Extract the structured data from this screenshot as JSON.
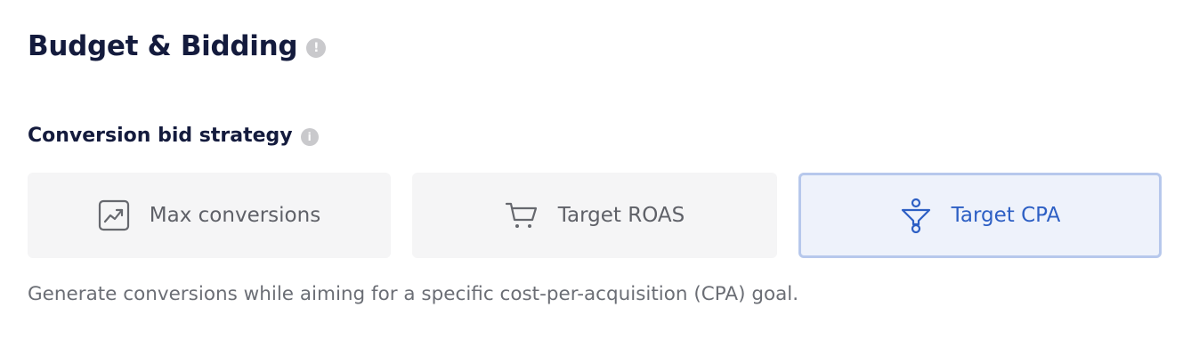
{
  "section": {
    "title": "Budget & Bidding",
    "info_glyph": "!"
  },
  "bid_strategy": {
    "label": "Conversion bid strategy",
    "info_glyph": "i",
    "options": [
      {
        "label": "Max conversions",
        "icon": "trend-chart-icon",
        "selected": false
      },
      {
        "label": "Target ROAS",
        "icon": "shopping-cart-icon",
        "selected": false
      },
      {
        "label": "Target CPA",
        "icon": "funnel-icon",
        "selected": true
      }
    ],
    "description": "Generate conversions while aiming for a specific cost-per-acquisition (CPA) goal."
  },
  "colors": {
    "heading": "#141b3d",
    "option_bg": "#f5f5f6",
    "selected_bg": "#eef2fb",
    "selected_border": "#b7c8ec",
    "selected_text": "#2d5fc4",
    "muted_text": "#6b6e75",
    "info_icon": "#c9c9cc"
  }
}
